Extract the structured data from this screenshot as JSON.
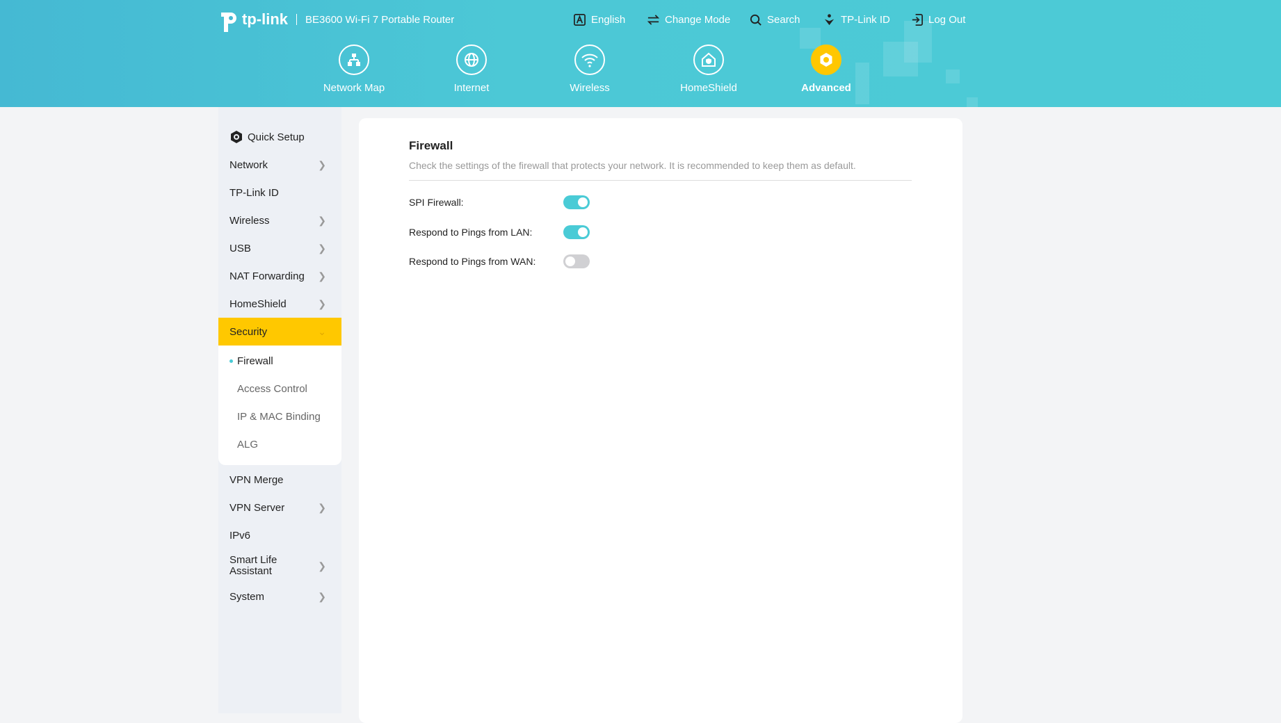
{
  "header": {
    "brand": "tp-link",
    "model": "BE3600 Wi-Fi 7 Portable Router",
    "links": [
      {
        "label": "English",
        "icon": "language-icon"
      },
      {
        "label": "Change Mode",
        "icon": "swap-icon"
      },
      {
        "label": "Search",
        "icon": "search-icon"
      },
      {
        "label": "TP-Link ID",
        "icon": "tplink-id-icon"
      },
      {
        "label": "Log Out",
        "icon": "logout-icon"
      }
    ],
    "nav": [
      {
        "label": "Network Map"
      },
      {
        "label": "Internet"
      },
      {
        "label": "Wireless"
      },
      {
        "label": "HomeShield"
      },
      {
        "label": "Advanced",
        "active": true
      }
    ]
  },
  "sidebar": {
    "quick_setup": "Quick Setup",
    "items_top": [
      "Network",
      "TP-Link ID",
      "Wireless",
      "USB",
      "NAT Forwarding",
      "HomeShield"
    ],
    "security": "Security",
    "security_sub": [
      "Firewall",
      "Access Control",
      "IP & MAC Binding",
      "ALG"
    ],
    "items_bottom": [
      "VPN Merge",
      "VPN Server",
      "IPv6",
      "Smart Life Assistant",
      "System"
    ]
  },
  "main": {
    "title": "Firewall",
    "description": "Check the settings of the firewall that protects your network. It is recommended to keep them as default.",
    "settings": [
      {
        "label": "SPI Firewall:",
        "enabled": true
      },
      {
        "label": "Respond to Pings from LAN:",
        "enabled": true
      },
      {
        "label": "Respond to Pings from WAN:",
        "enabled": false
      }
    ]
  },
  "colors": {
    "accent": "#4acbd6",
    "active": "#ffc800"
  }
}
